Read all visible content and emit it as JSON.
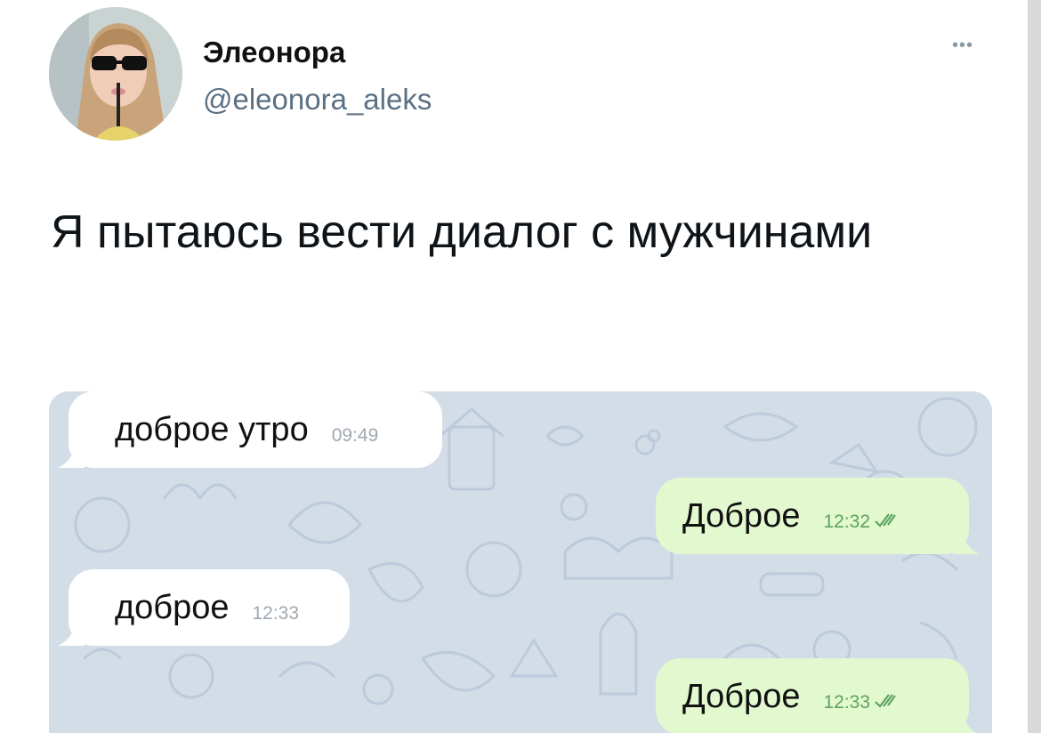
{
  "tweet": {
    "author_name": "Элеонора",
    "author_handle": "@eleonora_aleks",
    "more_icon": "more-icon",
    "text": "Я пытаюсь вести диалог с мужчинами"
  },
  "chat": {
    "messages": [
      {
        "direction": "incoming",
        "text": "доброе утро",
        "time": "09:49"
      },
      {
        "direction": "outgoing",
        "text": "Доброе",
        "time": "12:32",
        "status_icon": "double-check-icon"
      },
      {
        "direction": "incoming",
        "text": "доброе",
        "time": "12:33"
      },
      {
        "direction": "outgoing",
        "text": "Доброе",
        "time": "12:33",
        "status_icon": "double-check-icon"
      }
    ]
  },
  "colors": {
    "incoming_bubble": "#ffffff",
    "outgoing_bubble": "#e2f8cf",
    "chat_background": "#d3dde8",
    "handle_text": "#5b7083",
    "outgoing_time": "#5fa35f"
  }
}
